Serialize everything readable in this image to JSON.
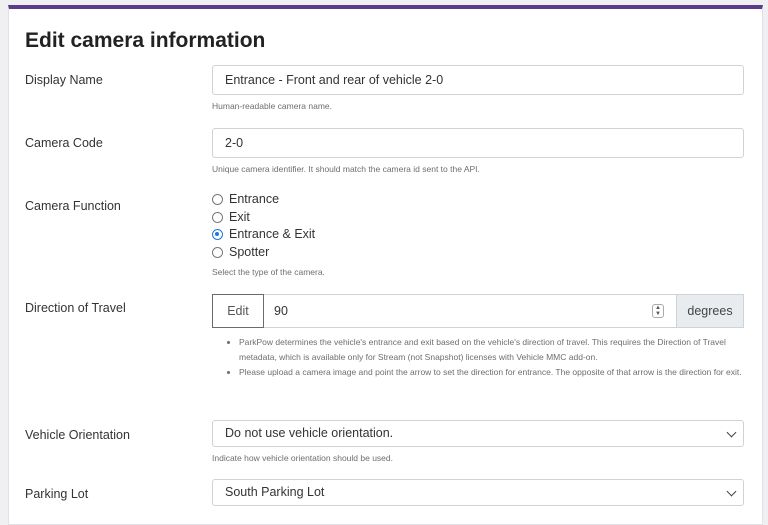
{
  "form": {
    "title": "Edit camera information",
    "display_name": {
      "label": "Display Name",
      "value": "Entrance - Front and rear of vehicle 2-0",
      "help": "Human-readable camera name."
    },
    "camera_code": {
      "label": "Camera Code",
      "value": "2-0",
      "help": "Unique camera identifier. It should match the camera id sent to the API."
    },
    "camera_function": {
      "label": "Camera Function",
      "options": [
        {
          "label": "Entrance",
          "checked": false
        },
        {
          "label": "Exit",
          "checked": false
        },
        {
          "label": "Entrance & Exit",
          "checked": true
        },
        {
          "label": "Spotter",
          "checked": false
        }
      ],
      "help": "Select the type of the camera."
    },
    "direction": {
      "label": "Direction of Travel",
      "edit_label": "Edit",
      "value": "90",
      "unit": "degrees",
      "notes": [
        "ParkPow determines the vehicle's entrance and exit based on the vehicle's direction of travel. This requires the Direction of Travel metadata, which is available only for Stream (not Snapshot) licenses with Vehicle MMC add-on.",
        "Please upload a camera image and point the arrow to set the direction for entrance. The opposite of that arrow is the direction for exit."
      ]
    },
    "vehicle_orientation": {
      "label": "Vehicle Orientation",
      "value": "Do not use vehicle orientation.",
      "help": "Indicate how vehicle orientation should be used."
    },
    "parking_lot": {
      "label": "Parking Lot",
      "value": "South Parking Lot"
    }
  },
  "colors": {
    "accent": "#5b3d87",
    "radio_checked": "#1e7ad6"
  },
  "icons": {
    "spinner": "up-down-spinner-icon",
    "select": "chevron-down-icon"
  }
}
